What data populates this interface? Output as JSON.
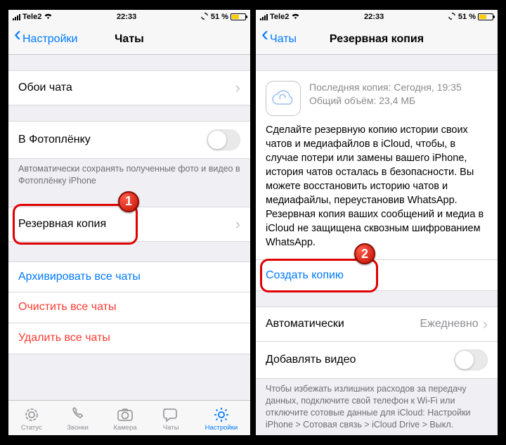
{
  "status": {
    "carrier": "Tele2",
    "time": "22:33",
    "battery_pct": "51 %",
    "sync_icon": "sync-icon"
  },
  "left": {
    "back_label": "Настройки",
    "title": "Чаты",
    "wallpaper": "Обои чата",
    "save_to_camera_roll": "В Фотоплёнку",
    "footer_camera": "Автоматически сохранять полученные фото и видео в Фотоплёнку iPhone",
    "backup": "Резервная копия",
    "archive_all": "Архивировать все чаты",
    "clear_all": "Очистить все чаты",
    "delete_all": "Удалить все чаты",
    "tabs": {
      "status": "Статус",
      "calls": "Звонки",
      "camera": "Камера",
      "chats": "Чаты",
      "settings": "Настройки"
    },
    "badge": "1"
  },
  "right": {
    "back_label": "Чаты",
    "title": "Резервная копия",
    "last_backup": "Последняя копия: Сегодня, 19:35",
    "total_size": "Общий объём: 23,4 МБ",
    "description": "Сделайте резервную копию истории своих чатов и медиафайлов в iCloud, чтобы, в случае потери или замены вашего iPhone, история чатов осталась в безопасности. Вы можете восстановить историю чатов и медиафайлы, переустановив WhatsApp. Резервная копия ваших сообщений и медиа в iCloud не защищена сквозным шифрованием WhatsApp.",
    "create_backup": "Создать копию",
    "auto_label": "Автоматически",
    "auto_value": "Ежедневно",
    "include_video": "Добавлять видео",
    "footer_data": "Чтобы избежать излишних расходов за передачу данных, подключите свой телефон к Wi-Fi или отключите сотовые данные для iCloud: Настройки iPhone > Сотовая связь > iCloud Drive > Выкл.",
    "badge": "2"
  }
}
